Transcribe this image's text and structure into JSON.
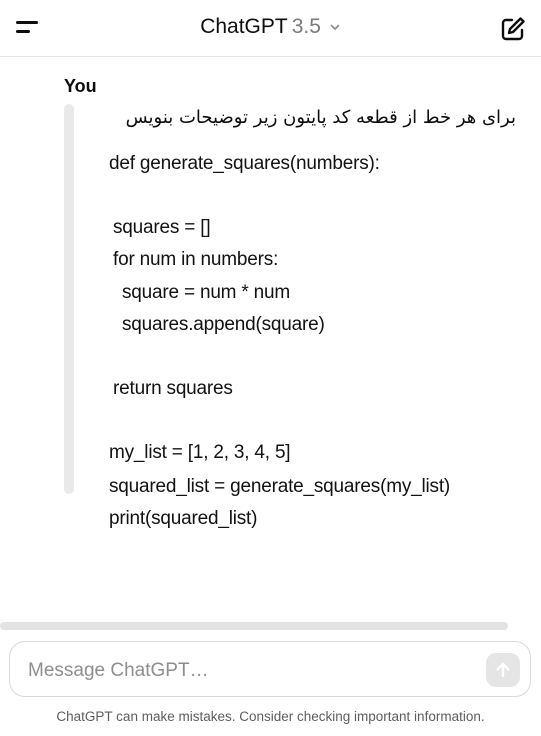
{
  "header": {
    "menu_icon": "menu-icon",
    "title": "ChatGPT",
    "version": "3.5",
    "dropdown_icon": "chevron-down-icon",
    "new_chat_icon": "new-chat-icon"
  },
  "message": {
    "author": "You",
    "prompt_text": "برای هر خط از قطعه کد پایتون زیر توضیحات بنویس",
    "code_lines": [
      "def generate_squares(numbers):",
      "squares = []",
      "for num in numbers:",
      "square = num * num",
      "squares.append(square)",
      "return squares",
      "my_list = [1, 2, 3, 4, 5]",
      "squared_list = generate_squares(my_list)",
      "print(squared_list)"
    ]
  },
  "composer": {
    "placeholder": "Message ChatGPT…",
    "value": "",
    "send_icon": "arrow-up-icon"
  },
  "footer": {
    "disclaimer": "ChatGPT can make mistakes. Consider checking important information."
  },
  "colors": {
    "background": "#ffffff",
    "text": "#0d0d0d",
    "muted": "#7a7a7a",
    "user_bar": "#e9e9e9",
    "send_button": "#e5e5e5"
  }
}
